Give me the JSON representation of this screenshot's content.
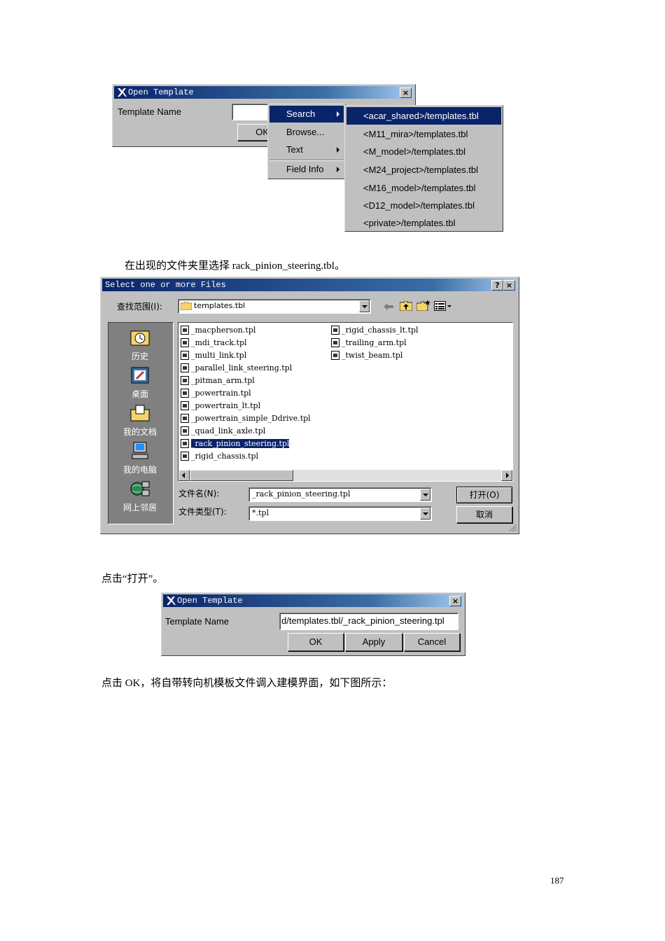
{
  "dialog1": {
    "title": "Open Template",
    "label": "Template Name",
    "ok_partial": "OK",
    "menu1": [
      "Search",
      "Browse...",
      "Text",
      "Field Info"
    ],
    "menu2": [
      "<acar_shared>/templates.tbl",
      "<M11_mira>/templates.tbl",
      "<M_model>/templates.tbl",
      "<M24_project>/templates.tbl",
      "<M16_model>/templates.tbl",
      "<D12_model>/templates.tbl",
      "<private>/templates.tbl"
    ]
  },
  "text1": "在出现的文件夹里选择 rack_pinion_steering.tbl。",
  "file_dialog": {
    "title": "Select one or more Files",
    "help_btn": "?",
    "close_btn": "×",
    "lookin_label": "查找范围(I):",
    "lookin_value": "templates.tbl",
    "places": [
      "历史",
      "桌面",
      "我的文档",
      "我的电脑",
      "网上邻居"
    ],
    "files_col1": [
      "_macpherson.tpl",
      "_mdi_track.tpl",
      "_multi_link.tpl",
      "_parallel_link_steering.tpl",
      "_pitman_arm.tpl",
      "_powertrain.tpl",
      "_powertrain_lt.tpl",
      "_powertrain_simple_Ddrive.tpl",
      "_quad_link_axle.tpl",
      "_rack_pinion_steering.tpl",
      "_rigid_chassis.tpl"
    ],
    "files_col2": [
      "_rigid_chassis_lt.tpl",
      "_trailing_arm.tpl",
      "_twist_beam.tpl"
    ],
    "filename_label": "文件名(N):",
    "filename_value": "_rack_pinion_steering.tpl",
    "filetype_label": "文件类型(T):",
    "filetype_value": "*.tpl",
    "open_btn": "打开(O)",
    "cancel_btn": "取消"
  },
  "text2": "点击“打开”。",
  "dialog2": {
    "title": "Open Template",
    "label": "Template Name",
    "value": "d/templates.tbl/_rack_pinion_steering.tpl",
    "ok": "OK",
    "apply": "Apply",
    "cancel": "Cancel"
  },
  "text3": "点击 OK，将自带转向机模板文件调入建模界面，如下图所示：",
  "page_number": "187"
}
